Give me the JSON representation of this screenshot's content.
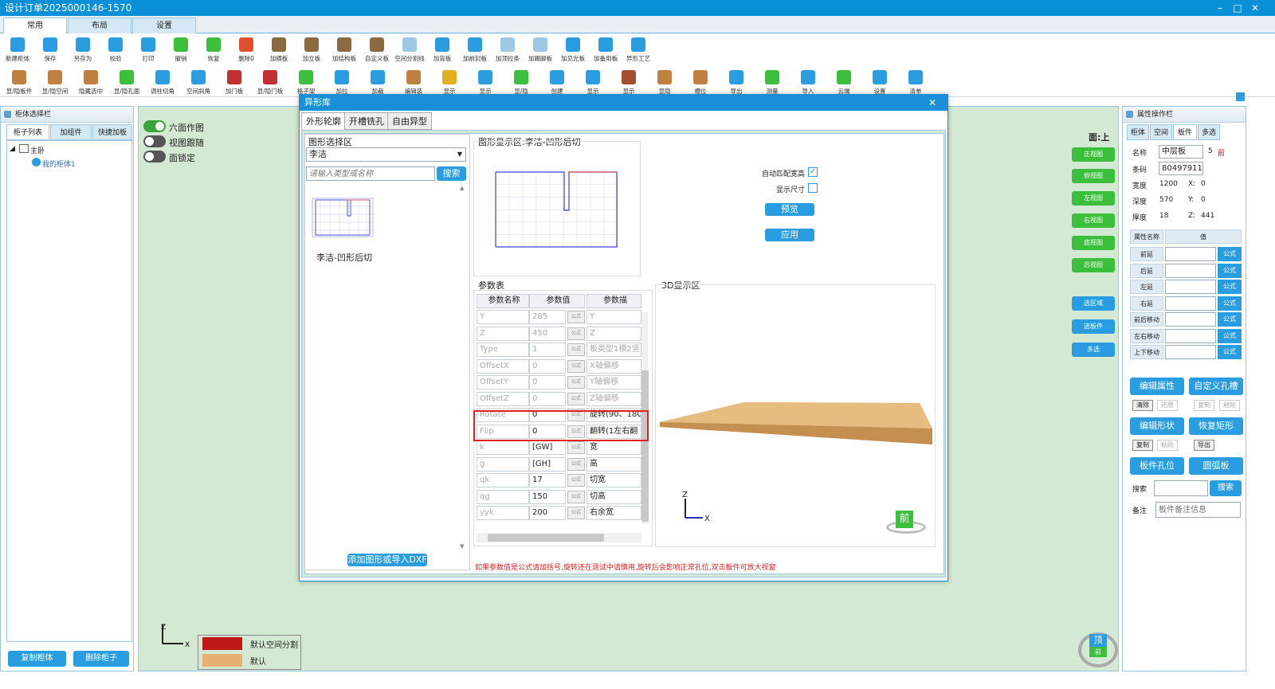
{
  "window": {
    "title": "设计订单2025000146-1570"
  },
  "ribbon_tabs": [
    "常用",
    "布局",
    "设置"
  ],
  "toolbar_row1": [
    {
      "label": "新建柜体",
      "icon": "new-cabinet-icon",
      "color": "#2a9de0"
    },
    {
      "label": "保存",
      "icon": "save-icon",
      "color": "#2a9de0"
    },
    {
      "label": "另存为",
      "icon": "save-as-icon",
      "color": "#2a9de0"
    },
    {
      "label": "校验",
      "icon": "check-icon",
      "color": "#2a9de0"
    },
    {
      "label": "打印",
      "icon": "print-icon",
      "color": "#2a9de0"
    },
    {
      "label": "撤销",
      "icon": "undo-icon",
      "color": "#3cbf3c"
    },
    {
      "label": "恢复",
      "icon": "redo-icon",
      "color": "#3cbf3c"
    },
    {
      "label": "删除0",
      "icon": "delete-icon",
      "color": "#e05030"
    },
    {
      "label": "加横板",
      "icon": "add-horizontal-board-icon",
      "color": "#8a6a40"
    },
    {
      "label": "加立板",
      "icon": "add-vertical-board-icon",
      "color": "#8a6a40"
    },
    {
      "label": "加结构板",
      "icon": "add-structure-board-icon",
      "color": "#8a6a40"
    },
    {
      "label": "自定义板",
      "icon": "custom-board-icon",
      "color": "#8a6a40"
    },
    {
      "label": "空间分割线",
      "icon": "space-split-icon",
      "color": "#9cc8e6"
    },
    {
      "label": "加背板",
      "icon": "add-back-board-icon",
      "color": "#2a9de0"
    },
    {
      "label": "加前封板",
      "icon": "add-front-seal-icon",
      "color": "#2a9de0"
    },
    {
      "label": "加顶拉条",
      "icon": "add-top-strip-icon",
      "color": "#9cc8e6"
    },
    {
      "label": "加踢脚板",
      "icon": "add-kickboard-icon",
      "color": "#9cc8e6"
    },
    {
      "label": "加见光板",
      "icon": "add-visible-board-icon",
      "color": "#2a9de0"
    },
    {
      "label": "加备用板",
      "icon": "add-spare-board-icon",
      "color": "#2a9de0"
    },
    {
      "label": "异形工艺",
      "icon": "special-shape-icon",
      "color": "#2a9de0"
    }
  ],
  "toolbar_row2": [
    {
      "label": "显/隐板件",
      "icon": "toggle-boards-icon",
      "color": "#c08040"
    },
    {
      "label": "显/隐空间",
      "icon": "toggle-space-icon",
      "color": "#c08040"
    },
    {
      "label": "隐藏选中",
      "icon": "hide-selected-icon",
      "color": "#c08040"
    },
    {
      "label": "显/隐孔面",
      "icon": "toggle-holes-icon",
      "color": "#3cbf3c"
    },
    {
      "label": "调柱切角",
      "icon": "column-cut-icon",
      "color": "#2a9de0"
    },
    {
      "label": "空间斜角",
      "icon": "space-bevel-icon",
      "color": "#2a9de0"
    },
    {
      "label": "加门板",
      "icon": "add-door-icon",
      "color": "#c03030"
    },
    {
      "label": "显/隐门板",
      "icon": "toggle-door-icon",
      "color": "#c03030"
    },
    {
      "label": "格子架",
      "icon": "grid-rack-icon",
      "color": "#3cbf3c"
    },
    {
      "label": "加拉",
      "icon": "add-pull-icon",
      "color": "#2a9de0"
    },
    {
      "label": "加裁",
      "icon": "add-cut-icon",
      "color": "#2a9de0"
    },
    {
      "label": "编辑装",
      "icon": "edit-hardware-icon",
      "color": "#c08040"
    },
    {
      "label": "显示",
      "icon": "show-icon",
      "color": "#e0b020"
    },
    {
      "label": "显示",
      "icon": "show-icon",
      "color": "#2a9de0"
    },
    {
      "label": "显/隐",
      "icon": "toggle-icon",
      "color": "#3cbf3c"
    },
    {
      "label": "创建",
      "icon": "create-icon",
      "color": "#2a9de0"
    },
    {
      "label": "显示",
      "icon": "show-icon",
      "color": "#2a9de0"
    },
    {
      "label": "显示",
      "icon": "show-icon",
      "color": "#a05030"
    },
    {
      "label": "显隐",
      "icon": "toggle-icon",
      "color": "#c08040"
    },
    {
      "label": "槽位",
      "icon": "slot-icon",
      "color": "#c08040"
    },
    {
      "label": "导出",
      "icon": "export-icon",
      "color": "#2a9de0"
    },
    {
      "label": "测量",
      "icon": "measure-icon",
      "color": "#3cbf3c"
    },
    {
      "label": "导入",
      "icon": "import-icon",
      "color": "#2a9de0"
    },
    {
      "label": "云端",
      "icon": "cloud-icon",
      "color": "#3cbf3c"
    },
    {
      "label": "设置",
      "icon": "settings-icon",
      "color": "#2a9de0"
    },
    {
      "label": "清单",
      "icon": "list-icon",
      "color": "#2a9de0"
    }
  ],
  "left_panel": {
    "title": "柜体选择栏",
    "tabs": [
      "柜子列表",
      "加组件",
      "快捷加板"
    ],
    "tree_root": "主卧",
    "tree_child": "我的柜体1",
    "copy_button": "复制柜体",
    "delete_button": "删除柜子"
  },
  "canvas": {
    "toggles": [
      {
        "label": "六面作图",
        "on": true
      },
      {
        "label": "视图跟随",
        "on": false
      },
      {
        "label": "面锁定",
        "on": false
      }
    ],
    "face_label": "面:上",
    "view_buttons": [
      "正视图",
      "俯视图",
      "左视图",
      "右视图",
      "底视图",
      "后视图"
    ],
    "select_buttons": [
      "选区域",
      "选板件",
      "多选"
    ],
    "legend": [
      {
        "label": "默认空间分割",
        "color": "#c01818"
      },
      {
        "label": "默认",
        "color": "#e8b070"
      }
    ],
    "cube_top": "顶",
    "cube_front": "前"
  },
  "dialog": {
    "title": "异形库",
    "tabs": [
      "外形轮廓",
      "开槽铣孔",
      "自由异型"
    ],
    "shape_select_title": "图形选择区",
    "category_value": "李洁",
    "search_placeholder": "请输入类型或名称",
    "search_button": "搜索",
    "shape_item_label": "李洁-凹形后切",
    "add_button": "添加图形或导入DXF",
    "display_title": "图形显示区:李洁-凹形后切",
    "auto_match_label": "自动匹配宽高",
    "show_size_label": "显示尺寸",
    "preview_button": "预览",
    "apply_button": "应用",
    "param_title": "参数表",
    "param_headers": [
      "参数名称",
      "参数值",
      "参数描"
    ],
    "params": [
      {
        "name": "Y",
        "value": "285",
        "desc": "Y",
        "disabled": true
      },
      {
        "name": "Z",
        "value": "450",
        "desc": "Z",
        "disabled": true
      },
      {
        "name": "Type",
        "value": "1",
        "desc": "板类型1横2竖",
        "disabled": true
      },
      {
        "name": "OffsetX",
        "value": "0",
        "desc": "X轴偏移",
        "disabled": true
      },
      {
        "name": "OffsetY",
        "value": "0",
        "desc": "Y轴偏移",
        "disabled": true
      },
      {
        "name": "OffsetZ",
        "value": "0",
        "desc": "Z轴偏移",
        "disabled": true
      },
      {
        "name": "Rotate",
        "value": "0",
        "desc": "旋转(90、180",
        "disabled": true
      },
      {
        "name": "Flip",
        "value": "0",
        "desc": "翻转(1左右翻",
        "disabled": true
      },
      {
        "name": "k",
        "value": "[GW]",
        "desc": "宽",
        "disabled": true
      },
      {
        "name": "g",
        "value": "[GH]",
        "desc": "高",
        "disabled": true
      },
      {
        "name": "qk",
        "value": "17",
        "desc": "切宽",
        "disabled": true
      },
      {
        "name": "qg",
        "value": "150",
        "desc": "切高",
        "disabled": true
      },
      {
        "name": "yyk",
        "value": "200",
        "desc": "右余宽",
        "disabled": true
      }
    ],
    "formula_label": "公式",
    "view3d_title": "3D显示区",
    "axis_z": "Z",
    "axis_x": "X",
    "cube_front": "前",
    "warning": "如果参数值是公式请加括号,旋转还在测试中请慎用,旋转后会影响正常孔位,双击板件可放大视窗"
  },
  "right_panel": {
    "title": "属性操作栏",
    "tabs": [
      "柜体",
      "空间",
      "板件",
      "多选"
    ],
    "name_label": "名称",
    "name_value": "中层板",
    "name_num": "5",
    "name_dir": "前",
    "code_label": "条码",
    "code_value": "80497911",
    "width_label": "宽度",
    "width_value": "1200",
    "x_label": "X:",
    "x_value": "0",
    "depth_label": "深度",
    "depth_value": "570",
    "y_label": "Y:",
    "y_value": "0",
    "thick_label": "厚度",
    "thick_value": "18",
    "z_label": "Z:",
    "z_value": "441",
    "attr_header": "属性名称",
    "value_header": "值",
    "attrs": [
      "前延",
      "后延",
      "左延",
      "右延",
      "前后移动",
      "左右移动",
      "上下移动"
    ],
    "formula_label": "公式",
    "edit_attr": "编辑属性",
    "custom_hole": "自定义孔槽",
    "clear": "清除",
    "restore": "还原",
    "copy": "复制",
    "paste": "粘贴",
    "edit_shape": "编辑形状",
    "restore_rect": "恢复矩形",
    "copy2": "复制",
    "paste2": "粘贴",
    "export": "导出",
    "hole_pos": "板件孔位",
    "arc_board": "圆弧板",
    "search_label": "搜索",
    "search_button": "搜索",
    "note_label": "备注",
    "note_placeholder": "板件备注信息"
  }
}
